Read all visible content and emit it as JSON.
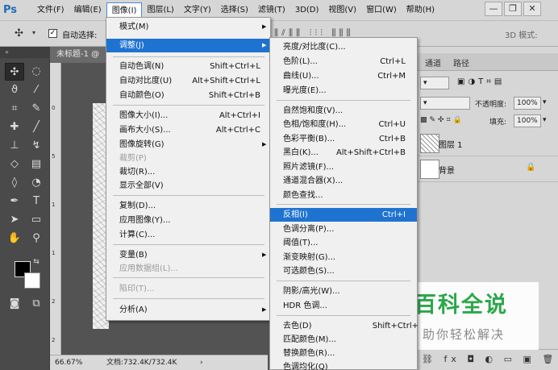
{
  "app": {
    "logo": "Ps"
  },
  "menubar": {
    "items": [
      {
        "label": "文件(F)"
      },
      {
        "label": "编辑(E)"
      },
      {
        "label": "图像(I)"
      },
      {
        "label": "图层(L)"
      },
      {
        "label": "文字(Y)"
      },
      {
        "label": "选择(S)"
      },
      {
        "label": "滤镜(T)"
      },
      {
        "label": "3D(D)"
      },
      {
        "label": "视图(V)"
      },
      {
        "label": "窗口(W)"
      },
      {
        "label": "帮助(H)"
      }
    ],
    "active": "图像(I)",
    "window_controls": {
      "minimize": "—",
      "restore": "❐",
      "close": "✕"
    }
  },
  "options_bar": {
    "auto_select_label": "自动选择:",
    "auto_select_checked": true,
    "mode_3d_label": "3D 模式:"
  },
  "document": {
    "tab_title": "未标题-1 @",
    "ruler_marks": [
      "0",
      "5",
      "1",
      "1",
      "2",
      "2"
    ],
    "zoom": "66.67%",
    "doc_size": "文档:732.4K/732.4K"
  },
  "right_panel": {
    "tabs": [
      "通道",
      "路径"
    ],
    "opacity_label": "不透明度:",
    "opacity_value": "100%",
    "fill_label": "填充:",
    "fill_value": "100%",
    "layers": [
      {
        "name": "图层 1",
        "locked": false
      },
      {
        "name": "背景",
        "locked": true
      }
    ]
  },
  "image_menu": {
    "items": [
      {
        "label": "模式(M)",
        "shortcut": "",
        "submenu": true,
        "state": "normal"
      },
      {
        "label": "调整(J)",
        "shortcut": "",
        "submenu": true,
        "state": "highlighted"
      },
      {
        "label": "自动色调(N)",
        "shortcut": "Shift+Ctrl+L",
        "submenu": false,
        "state": "normal"
      },
      {
        "label": "自动对比度(U)",
        "shortcut": "Alt+Shift+Ctrl+L",
        "submenu": false,
        "state": "normal"
      },
      {
        "label": "自动颜色(O)",
        "shortcut": "Shift+Ctrl+B",
        "submenu": false,
        "state": "normal"
      },
      {
        "label": "图像大小(I)...",
        "shortcut": "Alt+Ctrl+I",
        "submenu": false,
        "state": "normal"
      },
      {
        "label": "画布大小(S)...",
        "shortcut": "Alt+Ctrl+C",
        "submenu": false,
        "state": "normal"
      },
      {
        "label": "图像旋转(G)",
        "shortcut": "",
        "submenu": true,
        "state": "normal"
      },
      {
        "label": "裁剪(P)",
        "shortcut": "",
        "submenu": false,
        "state": "disabled"
      },
      {
        "label": "裁切(R)...",
        "shortcut": "",
        "submenu": false,
        "state": "normal"
      },
      {
        "label": "显示全部(V)",
        "shortcut": "",
        "submenu": false,
        "state": "normal"
      },
      {
        "label": "复制(D)...",
        "shortcut": "",
        "submenu": false,
        "state": "normal"
      },
      {
        "label": "应用图像(Y)...",
        "shortcut": "",
        "submenu": false,
        "state": "normal"
      },
      {
        "label": "计算(C)...",
        "shortcut": "",
        "submenu": false,
        "state": "normal"
      },
      {
        "label": "变量(B)",
        "shortcut": "",
        "submenu": true,
        "state": "normal"
      },
      {
        "label": "应用数据组(L)...",
        "shortcut": "",
        "submenu": false,
        "state": "disabled"
      },
      {
        "label": "陷印(T)...",
        "shortcut": "",
        "submenu": false,
        "state": "disabled"
      },
      {
        "label": "分析(A)",
        "shortcut": "",
        "submenu": true,
        "state": "normal"
      }
    ]
  },
  "adjust_menu": {
    "items": [
      {
        "label": "亮度/对比度(C)...",
        "shortcut": "",
        "state": "normal"
      },
      {
        "label": "色阶(L)...",
        "shortcut": "Ctrl+L",
        "state": "normal"
      },
      {
        "label": "曲线(U)...",
        "shortcut": "Ctrl+M",
        "state": "normal"
      },
      {
        "label": "曝光度(E)...",
        "shortcut": "",
        "state": "normal"
      },
      {
        "label": "自然饱和度(V)...",
        "shortcut": "",
        "state": "normal"
      },
      {
        "label": "色相/饱和度(H)...",
        "shortcut": "Ctrl+U",
        "state": "normal"
      },
      {
        "label": "色彩平衡(B)...",
        "shortcut": "Ctrl+B",
        "state": "normal"
      },
      {
        "label": "黑白(K)...",
        "shortcut": "Alt+Shift+Ctrl+B",
        "state": "normal"
      },
      {
        "label": "照片滤镜(F)...",
        "shortcut": "",
        "state": "normal"
      },
      {
        "label": "通道混合器(X)...",
        "shortcut": "",
        "state": "normal"
      },
      {
        "label": "颜色查找...",
        "shortcut": "",
        "state": "normal"
      },
      {
        "label": "反相(I)",
        "shortcut": "Ctrl+I",
        "state": "highlighted"
      },
      {
        "label": "色调分离(P)...",
        "shortcut": "",
        "state": "normal"
      },
      {
        "label": "阈值(T)...",
        "shortcut": "",
        "state": "normal"
      },
      {
        "label": "渐变映射(G)...",
        "shortcut": "",
        "state": "normal"
      },
      {
        "label": "可选颜色(S)...",
        "shortcut": "",
        "state": "normal"
      },
      {
        "label": "阴影/高光(W)...",
        "shortcut": "",
        "state": "normal"
      },
      {
        "label": "HDR 色调...",
        "shortcut": "",
        "state": "normal"
      },
      {
        "label": "去色(D)",
        "shortcut": "Shift+Ctrl+",
        "state": "normal"
      },
      {
        "label": "匹配颜色(M)...",
        "shortcut": "",
        "state": "normal"
      },
      {
        "label": "替换颜色(R)...",
        "shortcut": "",
        "state": "normal"
      },
      {
        "label": "色调均化(Q)",
        "shortcut": "",
        "state": "normal"
      }
    ]
  },
  "watermark": {
    "title": "百科全说",
    "subtitle": "助你轻松解决"
  },
  "colors": {
    "highlight": "#1f73d0",
    "ps_blue": "#1e6fb8",
    "watermark_green": "#2aa84a"
  }
}
